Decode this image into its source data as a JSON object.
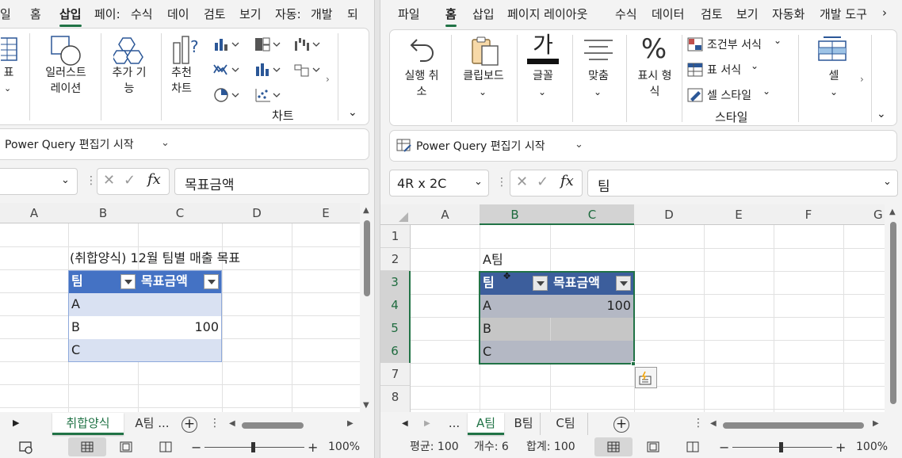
{
  "left": {
    "tabs": [
      "일",
      "홈",
      "삽입",
      "페이:",
      "수식",
      "데이",
      "검토",
      "보기",
      "자동:",
      "개발",
      "되"
    ],
    "active_tab": "삽입",
    "ribbon": {
      "table_label": "표",
      "illustrations_label": "일러스트\n레이션",
      "addins_label": "추가 기\n능",
      "recommended_charts_label": "추천\n차트",
      "charts_group": "차트"
    },
    "power_query": "Power Query 편집기 시작",
    "formula": "목표금액",
    "columns": [
      "A",
      "B",
      "C",
      "D",
      "E"
    ],
    "cells": {
      "title": "(취합양식) 12월 팀별 매출 목표",
      "h1": "팀",
      "h2": "목표금액",
      "r1": "A",
      "r2": "B",
      "r2v": "100",
      "r3": "C"
    },
    "sheets": [
      "취합양식",
      "A팀 ..."
    ],
    "active_sheet": "취합양식",
    "zoom": "100%"
  },
  "right": {
    "tabs": [
      "파일",
      "홈",
      "삽입",
      "페이지 레이아웃",
      "수식",
      "데이터",
      "검토",
      "보기",
      "자동화",
      "개발 도구"
    ],
    "active_tab": "홈",
    "ribbon": {
      "undo_label": "실행 취\n소",
      "clipboard_label": "클립보드",
      "font_label": "글꼴",
      "font_glyph": "가",
      "align_label": "맞춤",
      "number_label": "표시 형\n식",
      "cond_format": "조건부 서식",
      "table_format": "표 서식",
      "cell_style": "셀 스타일",
      "styles_group": "스타일",
      "cells_label": "셀"
    },
    "power_query": "Power Query 편집기 시작",
    "name_box": "4R x 2C",
    "formula": "팀",
    "columns": [
      "A",
      "B",
      "C",
      "D",
      "E",
      "F",
      "G"
    ],
    "rows": [
      "1",
      "2",
      "3",
      "4",
      "5",
      "6",
      "7",
      "8"
    ],
    "cells": {
      "b2": "A팀",
      "h1": "팀",
      "h2": "목표금액",
      "r1": "A",
      "r1v": "100",
      "r2": "B",
      "r3": "C"
    },
    "sheets": [
      "...",
      "A팀",
      "B팀",
      "C팀"
    ],
    "active_sheet": "A팀",
    "status": {
      "average": "평균: 100",
      "count": "개수: 6",
      "sum": "합계: 100"
    },
    "zoom": "100%"
  }
}
